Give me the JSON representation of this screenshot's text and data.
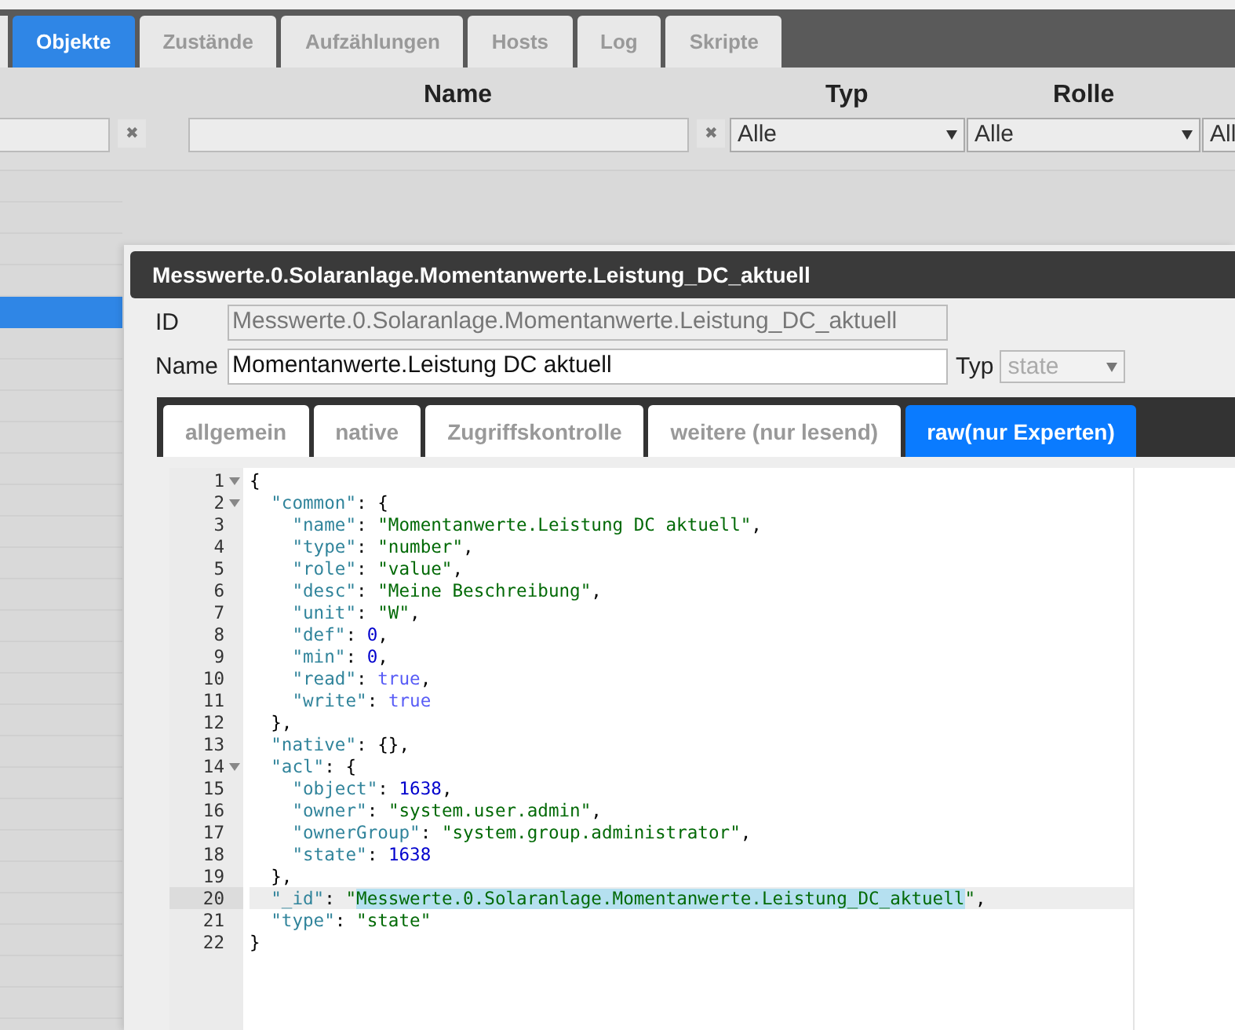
{
  "top_tabs": [
    {
      "label": "Objekte",
      "selected": true
    },
    {
      "label": "Zustände",
      "selected": false
    },
    {
      "label": "Aufzählungen",
      "selected": false
    },
    {
      "label": "Hosts",
      "selected": false
    },
    {
      "label": "Log",
      "selected": false
    },
    {
      "label": "Skripte",
      "selected": false
    }
  ],
  "filters": {
    "name_label": "Name",
    "typ_label": "Typ",
    "rolle_label": "Rolle",
    "clear_buttons": [
      "✖",
      "✖"
    ],
    "typ_select": "Alle",
    "rolle_select": "Alle",
    "extra_select": "All"
  },
  "sidebar": {
    "rows": [
      {
        "selected": false
      },
      {
        "selected": false
      },
      {
        "selected": false
      },
      {
        "selected": false
      },
      {
        "selected": true
      },
      {
        "selected": false
      },
      {
        "selected": false
      },
      {
        "selected": false
      },
      {
        "selected": false
      },
      {
        "selected": false
      },
      {
        "selected": false
      },
      {
        "selected": false
      },
      {
        "selected": false
      },
      {
        "selected": false
      },
      {
        "selected": false
      },
      {
        "selected": false
      },
      {
        "selected": false
      },
      {
        "selected": false
      },
      {
        "selected": false
      },
      {
        "selected": false
      },
      {
        "selected": false
      },
      {
        "selected": false
      },
      {
        "selected": false
      },
      {
        "selected": false
      },
      {
        "selected": false
      },
      {
        "selected": false
      },
      {
        "selected": false
      }
    ]
  },
  "dialog": {
    "title": "Messwerte.0.Solaranlage.Momentanwerte.Leistung_DC_aktuell",
    "id_label": "ID",
    "id_value": "Messwerte.0.Solaranlage.Momentanwerte.Leistung_DC_aktuell",
    "name_label": "Name",
    "name_value": "Momentanwerte.Leistung DC aktuell",
    "typ_label": "Typ",
    "typ_value": "state",
    "typ_disabled": true,
    "tabs": [
      {
        "label": "allgemein",
        "selected": false
      },
      {
        "label": "native",
        "selected": false
      },
      {
        "label": "Zugriffskontrolle",
        "selected": false
      },
      {
        "label": "weitere (nur lesend)",
        "selected": false
      },
      {
        "label": "raw(nur Experten)",
        "selected": true
      }
    ],
    "editor": {
      "lines": [
        {
          "number": "1",
          "foldable": true,
          "active": false,
          "segments": [
            {
              "kind": "punct",
              "text": "{"
            }
          ]
        },
        {
          "number": "2",
          "foldable": true,
          "active": false,
          "segments": [
            {
              "kind": "key",
              "text": "  \"common\""
            },
            {
              "kind": "punct",
              "text": ": {"
            }
          ]
        },
        {
          "number": "3",
          "foldable": false,
          "active": false,
          "segments": [
            {
              "kind": "key",
              "text": "    \"name\""
            },
            {
              "kind": "punct",
              "text": ": "
            },
            {
              "kind": "string",
              "text": "\"Momentanwerte.Leistung DC aktuell\""
            },
            {
              "kind": "punct",
              "text": ","
            }
          ]
        },
        {
          "number": "4",
          "foldable": false,
          "active": false,
          "segments": [
            {
              "kind": "key",
              "text": "    \"type\""
            },
            {
              "kind": "punct",
              "text": ": "
            },
            {
              "kind": "string",
              "text": "\"number\""
            },
            {
              "kind": "punct",
              "text": ","
            }
          ]
        },
        {
          "number": "5",
          "foldable": false,
          "active": false,
          "segments": [
            {
              "kind": "key",
              "text": "    \"role\""
            },
            {
              "kind": "punct",
              "text": ": "
            },
            {
              "kind": "string",
              "text": "\"value\""
            },
            {
              "kind": "punct",
              "text": ","
            }
          ]
        },
        {
          "number": "6",
          "foldable": false,
          "active": false,
          "segments": [
            {
              "kind": "key",
              "text": "    \"desc\""
            },
            {
              "kind": "punct",
              "text": ": "
            },
            {
              "kind": "string",
              "text": "\"Meine Beschreibung\""
            },
            {
              "kind": "punct",
              "text": ","
            }
          ]
        },
        {
          "number": "7",
          "foldable": false,
          "active": false,
          "segments": [
            {
              "kind": "key",
              "text": "    \"unit\""
            },
            {
              "kind": "punct",
              "text": ": "
            },
            {
              "kind": "string",
              "text": "\"W\""
            },
            {
              "kind": "punct",
              "text": ","
            }
          ]
        },
        {
          "number": "8",
          "foldable": false,
          "active": false,
          "segments": [
            {
              "kind": "key",
              "text": "    \"def\""
            },
            {
              "kind": "punct",
              "text": ": "
            },
            {
              "kind": "number",
              "text": "0"
            },
            {
              "kind": "punct",
              "text": ","
            }
          ]
        },
        {
          "number": "9",
          "foldable": false,
          "active": false,
          "segments": [
            {
              "kind": "key",
              "text": "    \"min\""
            },
            {
              "kind": "punct",
              "text": ": "
            },
            {
              "kind": "number",
              "text": "0"
            },
            {
              "kind": "punct",
              "text": ","
            }
          ]
        },
        {
          "number": "10",
          "foldable": false,
          "active": false,
          "segments": [
            {
              "kind": "key",
              "text": "    \"read\""
            },
            {
              "kind": "punct",
              "text": ": "
            },
            {
              "kind": "bool",
              "text": "true"
            },
            {
              "kind": "punct",
              "text": ","
            }
          ]
        },
        {
          "number": "11",
          "foldable": false,
          "active": false,
          "segments": [
            {
              "kind": "key",
              "text": "    \"write\""
            },
            {
              "kind": "punct",
              "text": ": "
            },
            {
              "kind": "bool",
              "text": "true"
            }
          ]
        },
        {
          "number": "12",
          "foldable": false,
          "active": false,
          "segments": [
            {
              "kind": "punct",
              "text": "  },"
            }
          ]
        },
        {
          "number": "13",
          "foldable": false,
          "active": false,
          "segments": [
            {
              "kind": "key",
              "text": "  \"native\""
            },
            {
              "kind": "punct",
              "text": ": {},"
            }
          ]
        },
        {
          "number": "14",
          "foldable": true,
          "active": false,
          "segments": [
            {
              "kind": "key",
              "text": "  \"acl\""
            },
            {
              "kind": "punct",
              "text": ": {"
            }
          ]
        },
        {
          "number": "15",
          "foldable": false,
          "active": false,
          "segments": [
            {
              "kind": "key",
              "text": "    \"object\""
            },
            {
              "kind": "punct",
              "text": ": "
            },
            {
              "kind": "number",
              "text": "1638"
            },
            {
              "kind": "punct",
              "text": ","
            }
          ]
        },
        {
          "number": "16",
          "foldable": false,
          "active": false,
          "segments": [
            {
              "kind": "key",
              "text": "    \"owner\""
            },
            {
              "kind": "punct",
              "text": ": "
            },
            {
              "kind": "string",
              "text": "\"system.user.admin\""
            },
            {
              "kind": "punct",
              "text": ","
            }
          ]
        },
        {
          "number": "17",
          "foldable": false,
          "active": false,
          "segments": [
            {
              "kind": "key",
              "text": "    \"ownerGroup\""
            },
            {
              "kind": "punct",
              "text": ": "
            },
            {
              "kind": "string",
              "text": "\"system.group.administrator\""
            },
            {
              "kind": "punct",
              "text": ","
            }
          ]
        },
        {
          "number": "18",
          "foldable": false,
          "active": false,
          "segments": [
            {
              "kind": "key",
              "text": "    \"state\""
            },
            {
              "kind": "punct",
              "text": ": "
            },
            {
              "kind": "number",
              "text": "1638"
            }
          ]
        },
        {
          "number": "19",
          "foldable": false,
          "active": false,
          "segments": [
            {
              "kind": "punct",
              "text": "  },"
            }
          ]
        },
        {
          "number": "20",
          "foldable": false,
          "active": true,
          "segments": [
            {
              "kind": "key",
              "text": "  \"_id\""
            },
            {
              "kind": "punct",
              "text": ": "
            },
            {
              "kind": "string",
              "text": "\""
            },
            {
              "kind": "selection",
              "text": "Messwerte.0.Solaranlage.Momentanwerte.Leistung_DC_aktuell"
            },
            {
              "kind": "string",
              "text": "\""
            },
            {
              "kind": "punct",
              "text": ","
            }
          ]
        },
        {
          "number": "21",
          "foldable": false,
          "active": false,
          "segments": [
            {
              "kind": "key",
              "text": "  \"type\""
            },
            {
              "kind": "punct",
              "text": ": "
            },
            {
              "kind": "string",
              "text": "\"state\""
            }
          ]
        },
        {
          "number": "22",
          "foldable": false,
          "active": false,
          "segments": [
            {
              "kind": "punct",
              "text": "}"
            }
          ]
        }
      ]
    }
  }
}
